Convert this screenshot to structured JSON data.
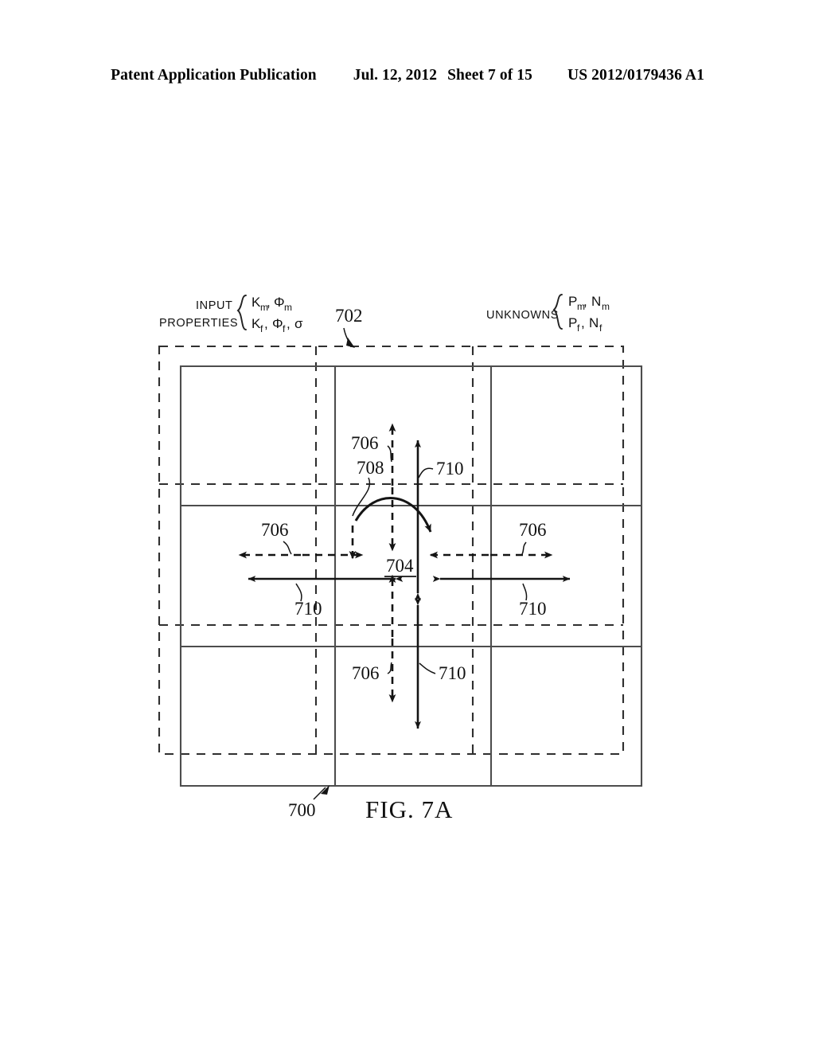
{
  "header": {
    "publication": "Patent Application Publication",
    "date": "Jul. 12, 2012",
    "sheet": "Sheet 7 of 15",
    "patent_number": "US 2012/0179436 A1"
  },
  "figure": {
    "caption": "FIG. 7A",
    "input_properties": {
      "label_line1": "INPUT",
      "label_line2": "PROPERTIES",
      "row1": {
        "sym1": "K",
        "sub1": "m",
        "sym2": "Φ",
        "sub2": "m",
        "sep": ", "
      },
      "row2": {
        "sym1": "K",
        "sub1": "f",
        "sym2": "Φ",
        "sub2": "f",
        "sym3": "σ",
        "sep": ", "
      },
      "row1_text": "Kₘ, Φₘ",
      "row2_text": "Kғ, Φғ, σ"
    },
    "unknowns": {
      "label": "UNKNOWNS",
      "row1": {
        "sym1": "P",
        "sub1": "m",
        "sym2": "N",
        "sub2": "m"
      },
      "row2": {
        "sym1": "P",
        "sub1": "f",
        "sym2": "N",
        "sub2": "f"
      }
    },
    "callouts": {
      "grid_system": "700",
      "dashed_grid": "702",
      "center_cell": "704",
      "dashed_flow": "706",
      "curved_flow": "708",
      "solid_flow": "710"
    },
    "ref_labels": {
      "top_dashed": "706",
      "top_curved": "708",
      "top_solid": "710",
      "left_dashed": "706",
      "left_solid": "710",
      "right_dashed": "706",
      "right_solid": "710",
      "bottom_dashed": "706",
      "bottom_solid": "710",
      "center": "704",
      "grid_outer": "700",
      "grid_dashed": "702"
    },
    "colors": {
      "ink": "#111111",
      "grid_solid": "#4a4a4a",
      "grid_dashed": "#3a3a3a",
      "background": "#ffffff"
    }
  }
}
